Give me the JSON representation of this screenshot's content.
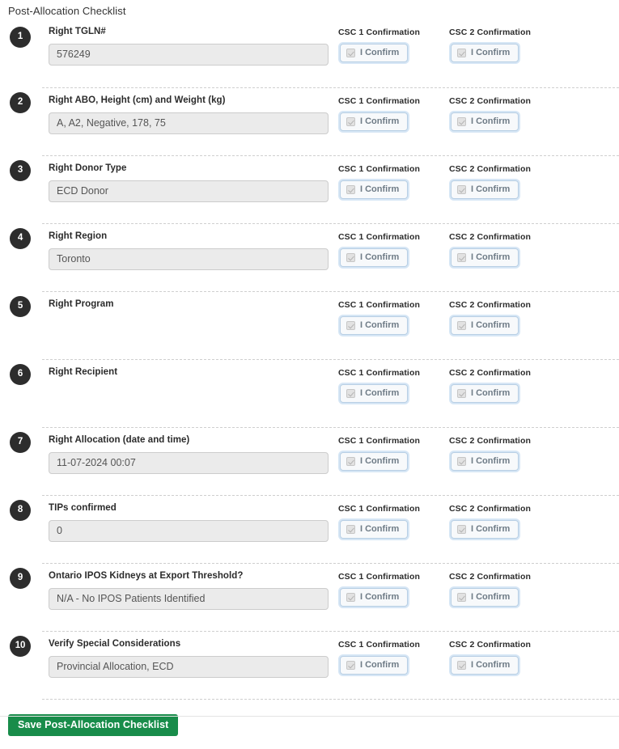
{
  "page": {
    "title": "Post-Allocation Checklist",
    "accent_green": "#188c4a",
    "badge_color": "#2d2d2d",
    "confirm_ring_color": "#d6e6f5"
  },
  "columns": {
    "csc1_header": "CSC 1 Confirmation",
    "csc2_header": "CSC 2 Confirmation",
    "confirm_button_label": "I Confirm"
  },
  "rows": [
    {
      "number": "1",
      "label": "Right TGLN#",
      "value": "576249",
      "has_input": true,
      "csc1_label": "CSC 1 Confirmation",
      "csc2_label": "CSC 2 Confirmation",
      "csc1_button": "I Confirm",
      "csc2_button": "I Confirm"
    },
    {
      "number": "2",
      "label": "Right ABO, Height (cm) and Weight (kg)",
      "value": "A, A2, Negative, 178, 75",
      "has_input": true,
      "csc1_label": "CSC 1 Confirmation",
      "csc2_label": "CSC 2 Confirmation",
      "csc1_button": "I Confirm",
      "csc2_button": "I Confirm"
    },
    {
      "number": "3",
      "label": "Right Donor Type",
      "value": "ECD Donor",
      "has_input": true,
      "csc1_label": "CSC 1 Confirmation",
      "csc2_label": "CSC 2 Confirmation",
      "csc1_button": "I Confirm",
      "csc2_button": "I Confirm"
    },
    {
      "number": "4",
      "label": "Right Region",
      "value": "Toronto",
      "has_input": true,
      "csc1_label": "CSC 1 Confirmation",
      "csc2_label": "CSC 2 Confirmation",
      "csc1_button": "I Confirm",
      "csc2_button": "I Confirm"
    },
    {
      "number": "5",
      "label": "Right Program",
      "value": "",
      "has_input": false,
      "csc1_label": "CSC 1 Confirmation",
      "csc2_label": "CSC 2 Confirmation",
      "csc1_button": "I Confirm",
      "csc2_button": "I Confirm"
    },
    {
      "number": "6",
      "label": "Right Recipient",
      "value": "",
      "has_input": false,
      "csc1_label": "CSC 1 Confirmation",
      "csc2_label": "CSC 2 Confirmation",
      "csc1_button": "I Confirm",
      "csc2_button": "I Confirm"
    },
    {
      "number": "7",
      "label": "Right Allocation (date and time)",
      "value": "11-07-2024 00:07",
      "has_input": true,
      "csc1_label": "CSC 1 Confirmation",
      "csc2_label": "CSC 2 Confirmation",
      "csc1_button": "I Confirm",
      "csc2_button": "I Confirm"
    },
    {
      "number": "8",
      "label": "TIPs confirmed",
      "value": "0",
      "has_input": true,
      "csc1_label": "CSC 1 Confirmation",
      "csc2_label": "CSC 2 Confirmation",
      "csc1_button": "I Confirm",
      "csc2_button": "I Confirm"
    },
    {
      "number": "9",
      "label": "Ontario IPOS Kidneys at Export Threshold?",
      "value": "N/A - No IPOS Patients Identified",
      "has_input": true,
      "csc1_label": "CSC 1 Confirmation",
      "csc2_label": "CSC 2 Confirmation",
      "csc1_button": "I Confirm",
      "csc2_button": "I Confirm"
    },
    {
      "number": "10",
      "label": "Verify Special Considerations",
      "value": "Provincial Allocation, ECD",
      "has_input": true,
      "csc1_label": "CSC 1 Confirmation",
      "csc2_label": "CSC 2 Confirmation",
      "csc1_button": "I Confirm",
      "csc2_button": "I Confirm"
    }
  ],
  "footer": {
    "save_label": "Save Post-Allocation Checklist"
  }
}
